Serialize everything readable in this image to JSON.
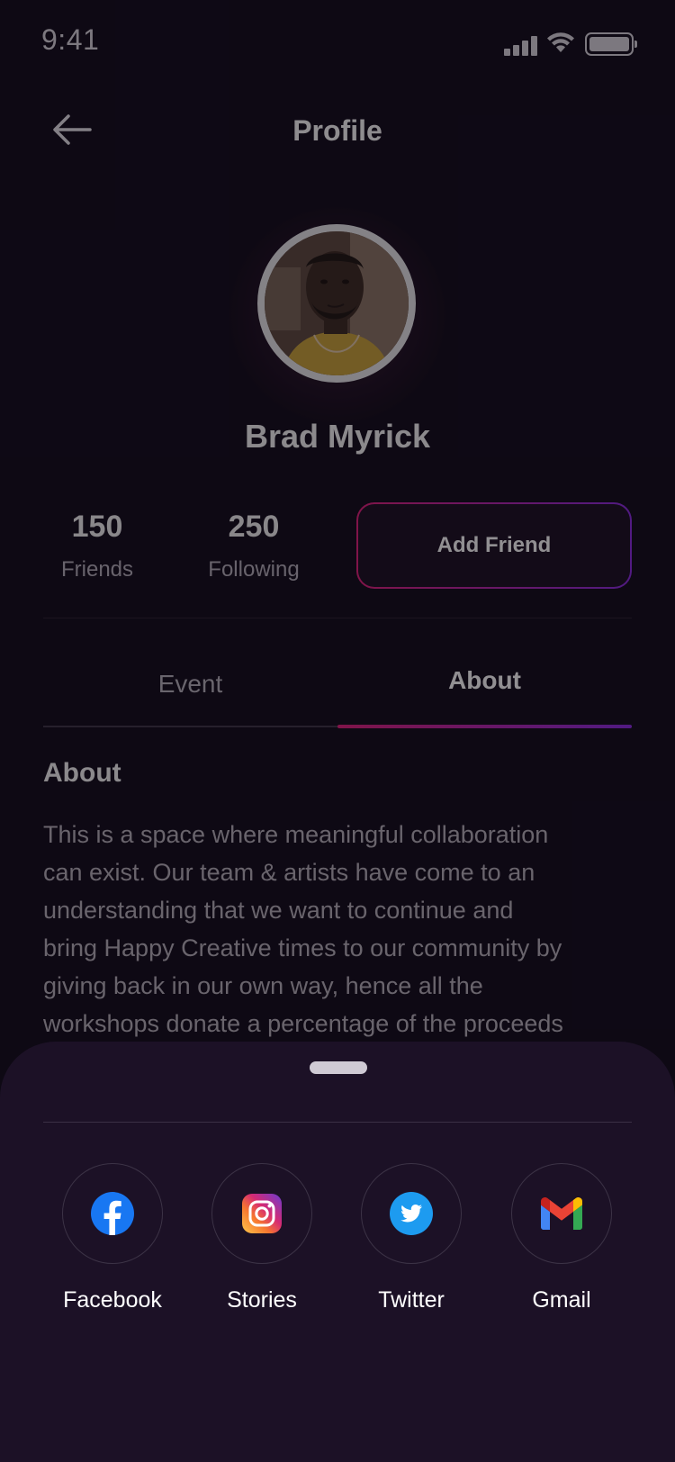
{
  "status_bar": {
    "time": "9:41"
  },
  "header": {
    "title": "Profile",
    "back_icon": "arrow-left-icon"
  },
  "profile": {
    "name": "Brad Myrick",
    "stats": [
      {
        "value": "150",
        "label": "Friends"
      },
      {
        "value": "250",
        "label": "Following"
      }
    ],
    "add_friend_label": "Add Friend"
  },
  "tabs": [
    {
      "label": "Event",
      "active": false
    },
    {
      "label": "About",
      "active": true
    }
  ],
  "about": {
    "heading": "About",
    "lines": [
      "This is a space where meaningful collaboration",
      "can exist. Our team & artists have come to an",
      "understanding that we want to continue and",
      "bring Happy Creative times to our community by",
      "giving back in our own way, hence all the",
      "workshops donate a percentage of the proceeds"
    ]
  },
  "share_sheet": {
    "options": [
      {
        "label": "Facebook",
        "icon": "facebook-icon"
      },
      {
        "label": "Stories",
        "icon": "instagram-icon"
      },
      {
        "label": "Twitter",
        "icon": "twitter-icon"
      },
      {
        "label": "Gmail",
        "icon": "gmail-icon"
      }
    ]
  },
  "colors": {
    "background": "#120c1a",
    "accent_pink": "#e0207a",
    "accent_purple": "#8a2be2",
    "sheet": "#1c1126"
  }
}
